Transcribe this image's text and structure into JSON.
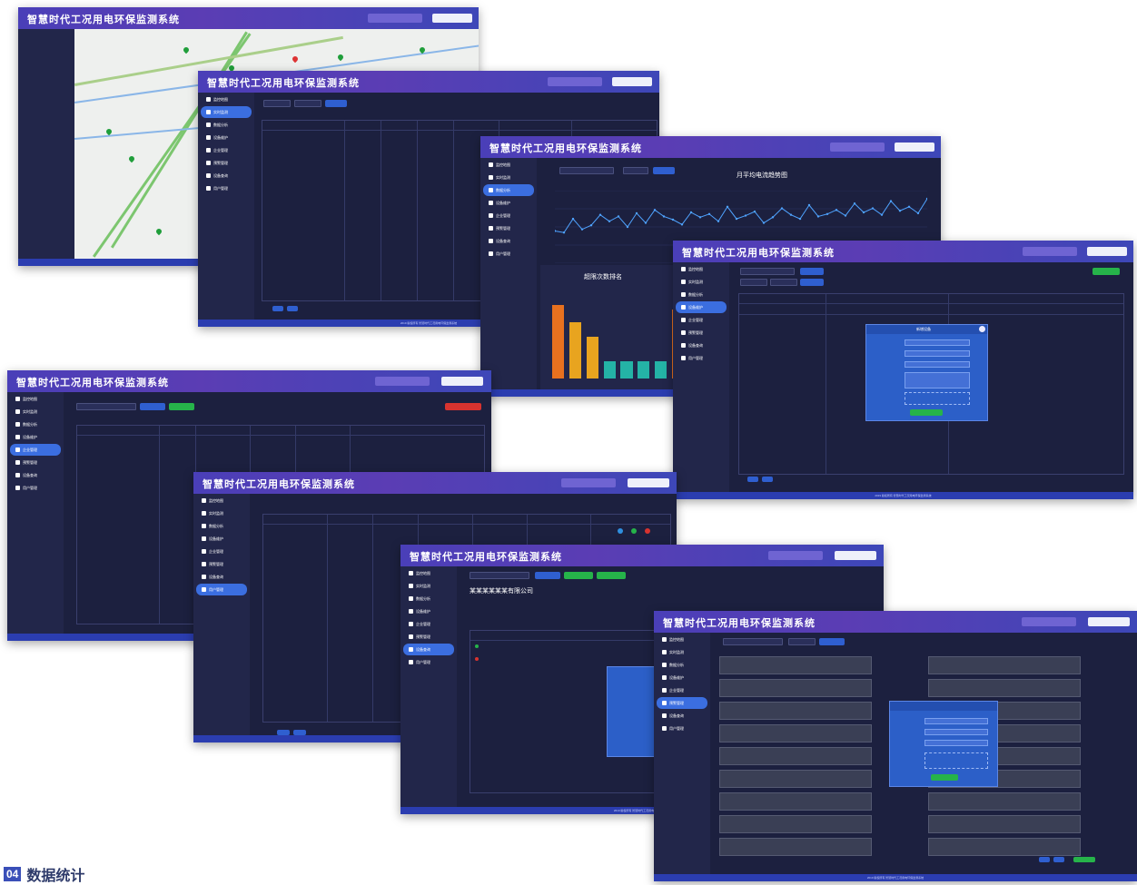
{
  "app": {
    "title": "智慧时代工况用电环保监测系统"
  },
  "sidebar": {
    "items": [
      "监控地图",
      "实时监测",
      "数据分析",
      "设备维护",
      "企业管理",
      "预警管理",
      "设备查询",
      "用户管理"
    ]
  },
  "charts": {
    "line_title": "月平均电流趋势图",
    "bar_title": "超限次数排名"
  },
  "modal1": {
    "title": "新增设备"
  },
  "company": {
    "name": "某某某某某某有限公司"
  },
  "footer": {
    "text": "2019 版权所有 智慧时代工况用电环保监测系统"
  },
  "section": {
    "number": "04",
    "label": "数据统计"
  },
  "chart_data": [
    {
      "type": "line",
      "title": "月平均电流趋势图",
      "xlabel": "",
      "ylabel": "",
      "series": [
        {
          "values": [
            40,
            38,
            55,
            42,
            47,
            60,
            52,
            58,
            45,
            62,
            50,
            66,
            58,
            54,
            48,
            63,
            57,
            61,
            52,
            70,
            55,
            59,
            64,
            50,
            57,
            68,
            60,
            55,
            72,
            58,
            61,
            66,
            59,
            74,
            63,
            68,
            60,
            77,
            65,
            70,
            62,
            80
          ]
        }
      ]
    },
    {
      "type": "bar",
      "title": "超限次数排名",
      "xlabel": "",
      "ylabel": "",
      "values": [
        85,
        65,
        48,
        20,
        20,
        20,
        20,
        80,
        60
      ],
      "colors": [
        "#e8711f",
        "#e8a41f",
        "#e8a41f",
        "#24b3a6",
        "#24b3a6",
        "#24b3a6",
        "#24b3a6",
        "#e8711f",
        "#e8a41f"
      ]
    }
  ]
}
